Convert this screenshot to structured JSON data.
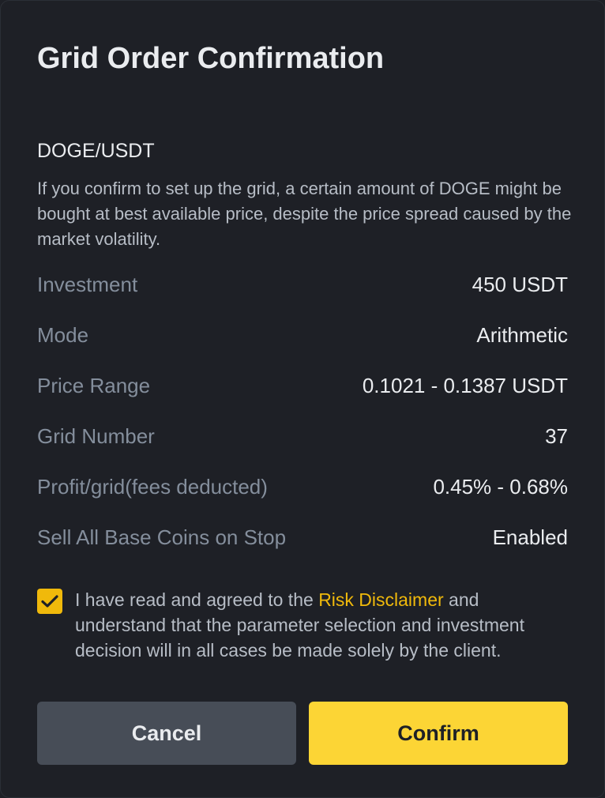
{
  "dialog": {
    "title": "Grid Order Confirmation",
    "pair": "DOGE/USDT",
    "description": "If you confirm to set up the grid, a certain amount of DOGE might be bought at best available price, despite the price spread caused by the market volatility."
  },
  "details": [
    {
      "label": "Investment",
      "value": "450 USDT"
    },
    {
      "label": "Mode",
      "value": "Arithmetic"
    },
    {
      "label": "Price Range",
      "value": "0.1021 - 0.1387 USDT"
    },
    {
      "label": "Grid Number",
      "value": "37"
    },
    {
      "label": "Profit/grid(fees deducted)",
      "value": "0.45% - 0.68%"
    },
    {
      "label": "Sell All Base Coins on Stop",
      "value": "Enabled"
    }
  ],
  "agreement": {
    "checked": true,
    "text_before": "I have read and agreed to the ",
    "link_text": "Risk Disclaimer",
    "text_after": " and understand that the parameter selection and investment decision will in all cases be made solely by the client."
  },
  "buttons": {
    "cancel": "Cancel",
    "confirm": "Confirm"
  },
  "colors": {
    "background": "#1e2026",
    "accent": "#f0b90b",
    "confirm_button": "#fcd535",
    "cancel_button": "#474d57"
  }
}
